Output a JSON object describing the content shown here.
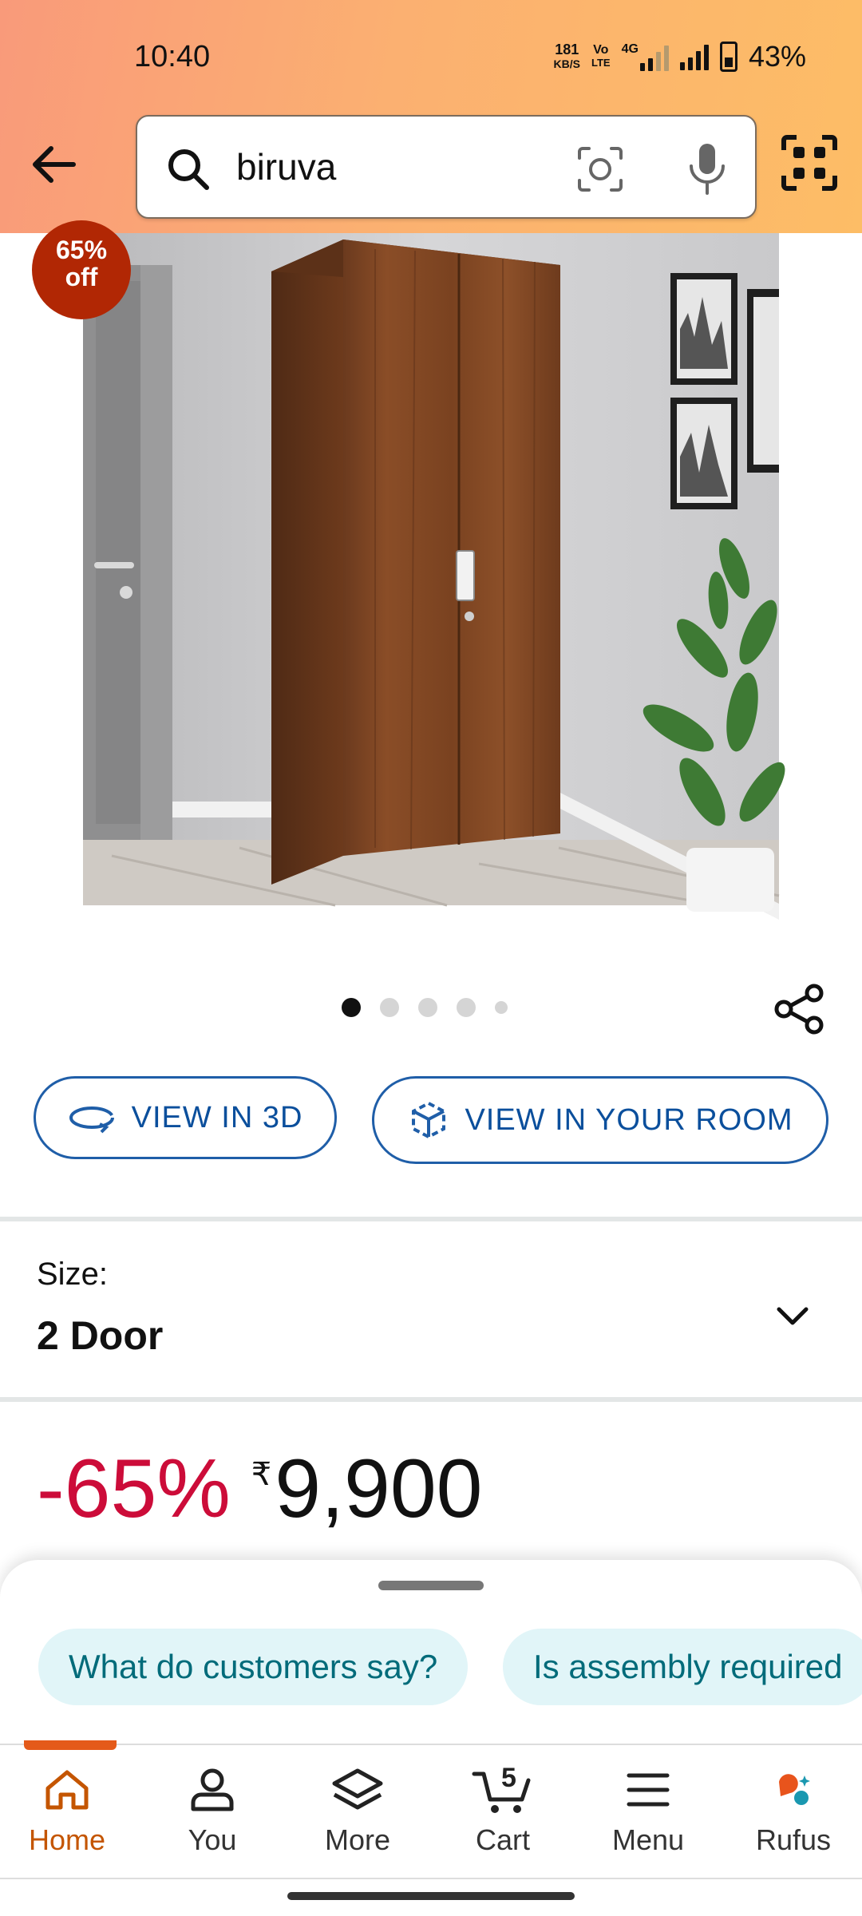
{
  "status_bar": {
    "time": "10:40",
    "net_speed_value": "181",
    "net_speed_unit": "KB/S",
    "volte_top": "Vo",
    "volte_bottom": "LTE",
    "network_type": "4G",
    "battery_pct": "43%"
  },
  "search": {
    "query": "biruva"
  },
  "product": {
    "discount_badge_line1": "65%",
    "discount_badge_line2": "off",
    "image_count": 5,
    "active_image_index": 0
  },
  "actions": {
    "view_3d_label": "VIEW IN 3D",
    "view_room_label": "VIEW IN YOUR ROOM"
  },
  "size": {
    "label": "Size:",
    "value": "2 Door"
  },
  "price": {
    "discount": "-65%",
    "currency": "₹",
    "amount": "9,900"
  },
  "suggestions": {
    "chips": [
      "What do customers say?",
      "Is assembly required"
    ]
  },
  "nav": {
    "items": [
      {
        "label": "Home",
        "icon": "home-icon"
      },
      {
        "label": "You",
        "icon": "person-icon"
      },
      {
        "label": "More",
        "icon": "layers-icon"
      },
      {
        "label": "Cart",
        "icon": "cart-icon"
      },
      {
        "label": "Menu",
        "icon": "menu-icon"
      },
      {
        "label": "Rufus",
        "icon": "rufus-icon"
      }
    ],
    "cart_count": "5",
    "active": "Home"
  },
  "colors": {
    "accent_orange": "#c45500",
    "discount_red": "#cc0c39",
    "link_blue": "#0b4f9c",
    "chip_bg": "#e1f5f8"
  }
}
